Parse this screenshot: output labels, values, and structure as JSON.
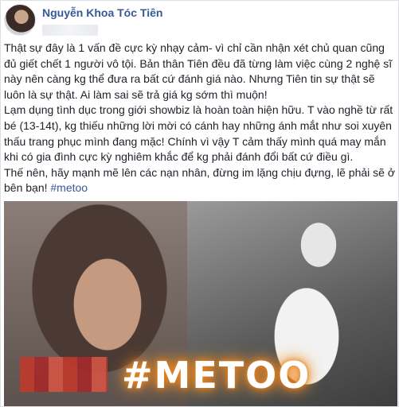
{
  "post": {
    "author": "Nguyễn Khoa Tóc Tiên",
    "paragraphs": [
      "Thật sự đây là 1 vấn đề cực kỳ nhạy cảm- vì chỉ cần nhận xét chủ quan cũng đủ giết chết 1 người vô tội. Bản thân Tiên đều đã từng làm việc cùng 2 nghệ sĩ này nên càng kg thể đưa ra bất cứ đánh giá nào. Nhưng Tiên tin sự thật sẽ luôn là sự thật. Ai làm sai sẽ trả giá kg sớm thì muộn!",
      "Lạm dụng tình dục trong giới showbiz là hoàn toàn hiện hữu. T vào nghề từ rất bé (13-14t), kg thiếu những lời mời có cánh hay những ánh mắt như soi xuyên thấu trang phục mình đang mặc! Chính vì vậy T cảm thấy mình quá may mắn khi có gia đình cực kỳ nghiêm khắc để kg phải đánh đổi bất cứ điều gì."
    ],
    "last_paragraph_text": "Thế nên, hãy mạnh mẽ lên các nạn nhân, đừng im lặng chịu đựng, lẽ phải sẽ ở bên bạn! ",
    "hashtag": "#metoo"
  },
  "media": {
    "overlay_text": "#METOO",
    "glow_color": "#e6801c"
  },
  "colors": {
    "author_link": "#365899",
    "body_text": "#1d2129"
  }
}
